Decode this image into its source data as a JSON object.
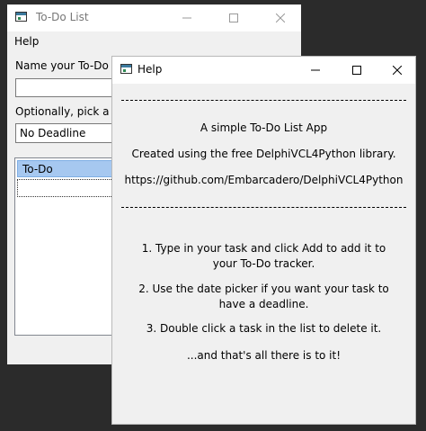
{
  "todo_window": {
    "title": "To-Do List",
    "menu": [
      "Help"
    ],
    "name_label": "Name your To-Do he",
    "name_value": "",
    "deadline_label": "Optionally, pick a de",
    "deadline_value": "No Deadline",
    "list_header": "To-Do",
    "list_items": []
  },
  "help_window": {
    "title": "Help",
    "about_lines": [
      "A simple To-Do List App",
      "Created using the free DelphiVCL4Python library.",
      "https://github.com/Embarcadero/DelphiVCL4Python"
    ],
    "instructions": [
      "1. Type in your task and click Add to add it to your To-Do tracker.",
      "2. Use the date picker if you want your task to have a deadline.",
      "3. Double click a task in the list to delete it.",
      "...and that's all there is to it!"
    ]
  }
}
